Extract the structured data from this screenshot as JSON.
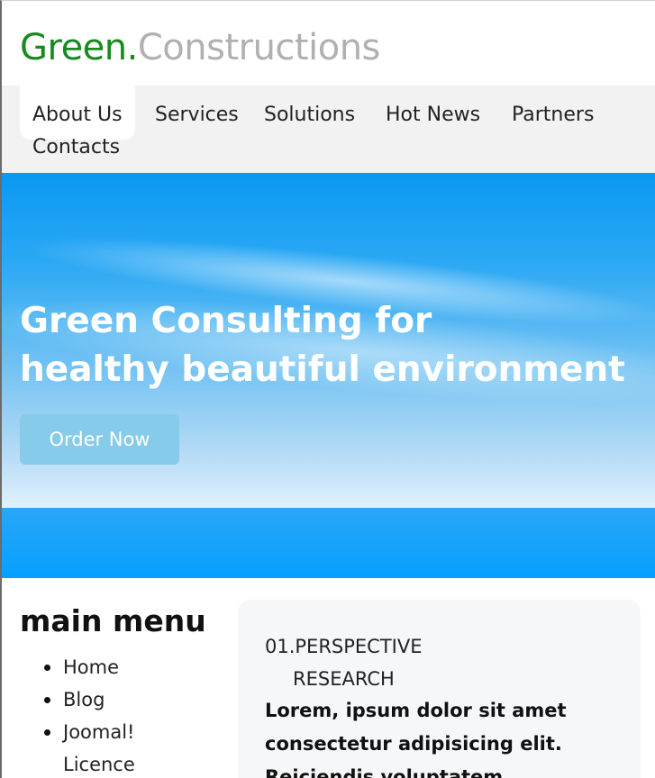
{
  "header": {
    "logo_part1": "Green.",
    "logo_part2": "Constructions",
    "colors": {
      "brand_green": "#178a1e",
      "brand_grey": "#b0b0b0"
    }
  },
  "nav": {
    "items": [
      {
        "label": "About Us",
        "active": true
      },
      {
        "label": "Services"
      },
      {
        "label": "Solutions"
      },
      {
        "label": "Hot News"
      },
      {
        "label": "Partners"
      },
      {
        "label": "Contacts"
      }
    ]
  },
  "hero": {
    "title_line1": "Green Consulting for",
    "title_line2": "healthy beautiful environment",
    "button_label": "Order Now",
    "colors": {
      "sky": "#0a98f2",
      "button": "#86cbe9"
    }
  },
  "sidebar": {
    "title": "main menu",
    "items": [
      "Home",
      "Blog",
      "Joomal!",
      "Licence"
    ]
  },
  "card": {
    "heading_line1": "01.PERSPECTIVE",
    "heading_line2": "RESEARCH",
    "body": "Lorem, ipsum dolor sit amet consectetur adipisicing elit. Reiciendis voluptatem"
  }
}
